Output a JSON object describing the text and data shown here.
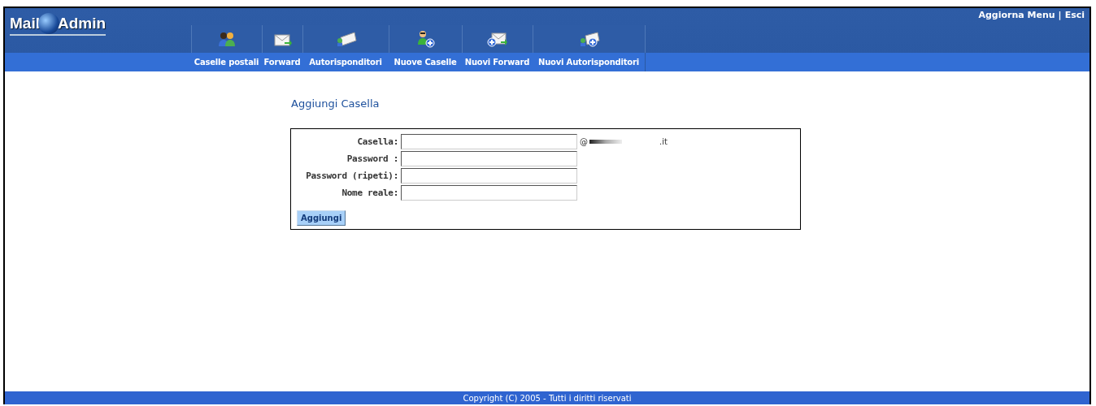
{
  "header": {
    "logo_left": "Mail",
    "logo_right": "Admin",
    "links": [
      "Aggiorna Menu",
      "Esci"
    ],
    "separator": "|"
  },
  "menu": [
    {
      "label": "Caselle postali",
      "kind": "people"
    },
    {
      "label": "Forward",
      "kind": "forward"
    },
    {
      "label": "Autorisponditori",
      "kind": "autoreply"
    },
    {
      "label": "Nuove Caselle",
      "kind": "newuser"
    },
    {
      "label": "Nuovi Forward",
      "kind": "newforward"
    },
    {
      "label": "Nuovi Autorisponditori",
      "kind": "newautoreply"
    }
  ],
  "form": {
    "title": "Aggiungi Casella",
    "fields": [
      {
        "label": "Casella:",
        "suffix_at": "@",
        "suffix_domain": ".it"
      },
      {
        "label": "Password :"
      },
      {
        "label": "Password (ripeti):"
      },
      {
        "label": "Nome reale:"
      }
    ],
    "button": "Aggiungi"
  },
  "footer": "Copyright (C) 2005 - Tutti i diritti riservati"
}
